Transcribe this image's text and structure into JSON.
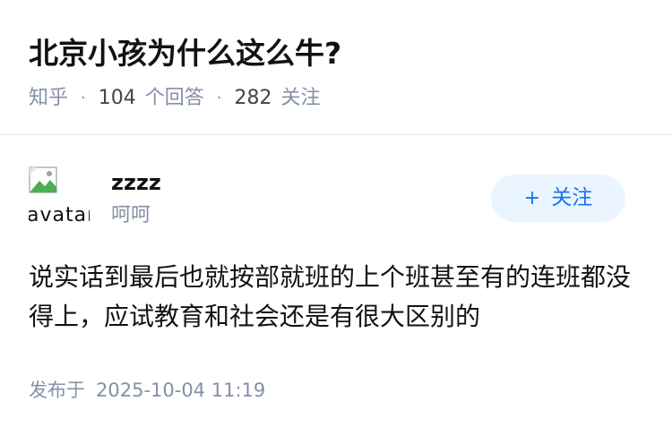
{
  "question": {
    "title": "北京小孩为什么这么牛?",
    "source": "知乎",
    "answer_count": "104",
    "answer_label": "个回答",
    "follow_count": "282",
    "follow_label": "关注"
  },
  "author": {
    "avatar_alt": "avatar",
    "name": "zzzz",
    "bio": "呵呵",
    "follow_button_label": "关注",
    "follow_icon": "plus-icon"
  },
  "answer": {
    "content": "说实话到最后也就按部就班的上个班甚至有的连班都没得上，应试教育和社会还是有很大区别的",
    "published_label": "发布于",
    "published_time": "2025-10-04 11:19"
  },
  "colors": {
    "accent": "#1772f6",
    "follow_bg": "#ebf5ff",
    "meta_gray": "#8590a6"
  }
}
